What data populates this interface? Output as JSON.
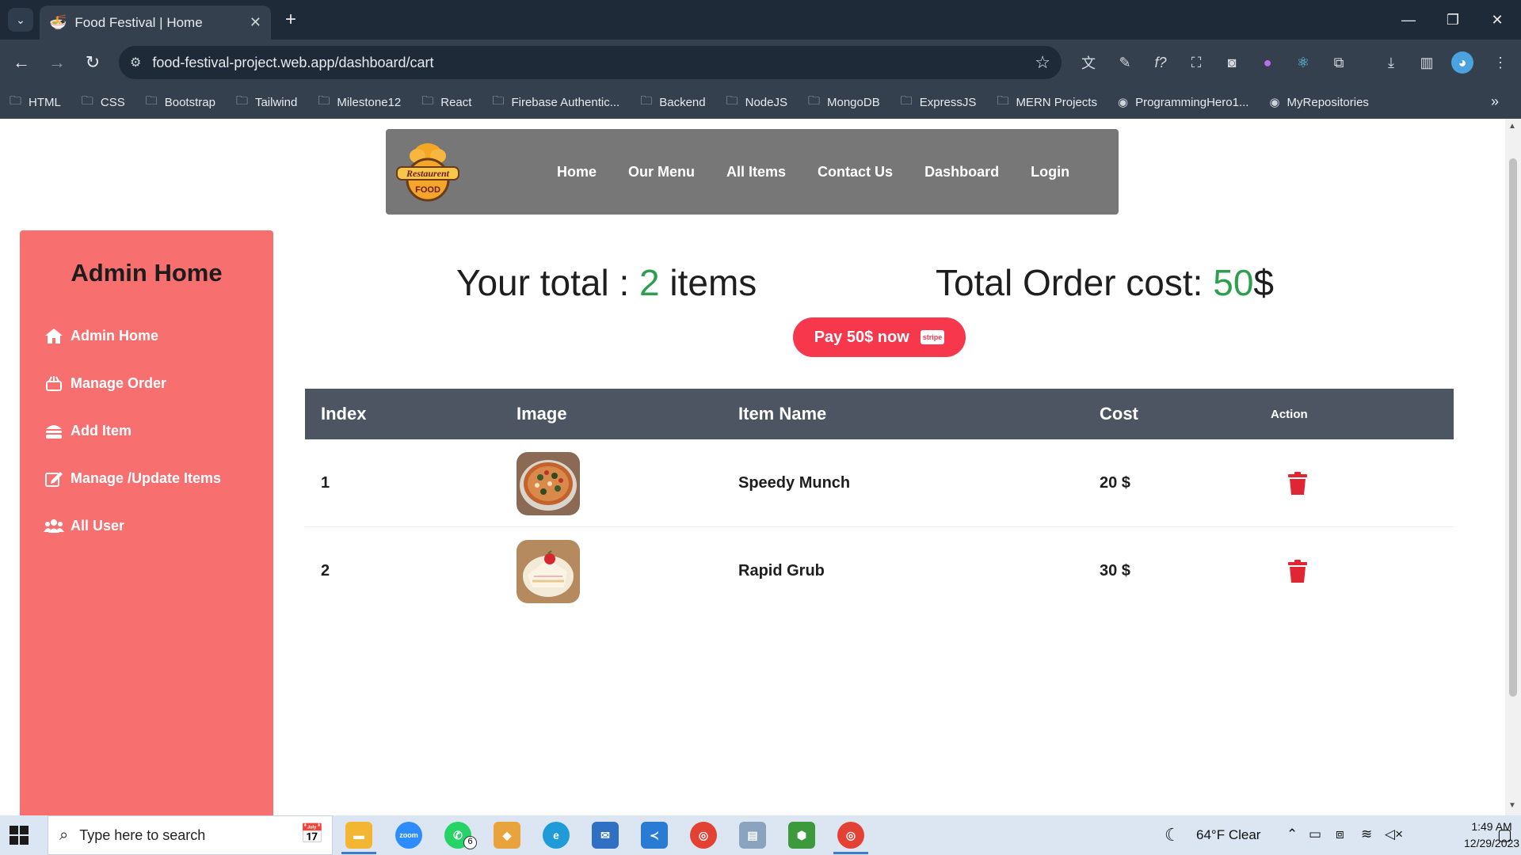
{
  "browser": {
    "tab_title": "Food Festival | Home",
    "url": "food-festival-project.web.app/dashboard/cart",
    "bookmarks": [
      "HTML",
      "CSS",
      "Bootstrap",
      "Tailwind",
      "Milestone12",
      "React",
      "Firebase Authentic...",
      "Backend",
      "NodeJS",
      "MongoDB",
      "ExpressJS",
      "MERN Projects",
      "ProgrammingHero1...",
      "MyRepositories"
    ]
  },
  "navbar": {
    "logo_text_1": "Restaurent",
    "logo_text_2": "FOOD",
    "links": [
      "Home",
      "Our Menu",
      "All Items",
      "Contact Us",
      "Dashboard",
      "Login"
    ]
  },
  "sidebar": {
    "title": "Admin Home",
    "items": [
      {
        "label": "Admin Home",
        "icon": "home-icon"
      },
      {
        "label": "Manage Order",
        "icon": "food-order-icon"
      },
      {
        "label": "Add Item",
        "icon": "burger-icon"
      },
      {
        "label": "Manage /Update Items",
        "icon": "edit-icon"
      },
      {
        "label": "All User",
        "icon": "users-icon"
      }
    ]
  },
  "summary": {
    "total_prefix": "Your total : ",
    "total_count": "2",
    "total_suffix": " items",
    "cost_prefix": "Total Order cost: ",
    "cost_value": "50",
    "cost_suffix": "$"
  },
  "pay_button": {
    "label": "Pay 50$ now",
    "badge": "stripe"
  },
  "table": {
    "headers": [
      "Index",
      "Image",
      "Item Name",
      "Cost",
      "Action"
    ],
    "rows": [
      {
        "index": "1",
        "name": "Speedy Munch",
        "cost": "20 $",
        "image": "pizza"
      },
      {
        "index": "2",
        "name": "Rapid Grub",
        "cost": "30 $",
        "image": "cake"
      }
    ]
  },
  "taskbar": {
    "search_placeholder": "Type here to search",
    "weather": "64°F  Clear",
    "time": "1:49 AM",
    "date": "12/29/2023",
    "whatsapp_badge": "6"
  },
  "colors": {
    "accent_red": "#f7374c",
    "sidebar": "#f76f6f",
    "green": "#2e9e4f",
    "table_head": "#4d5563"
  }
}
